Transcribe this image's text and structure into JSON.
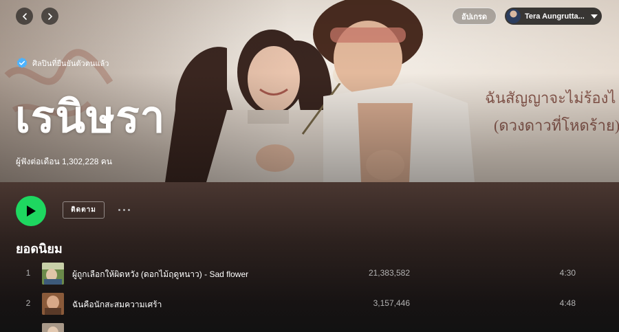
{
  "nav": {
    "back_icon": "chevron-left-icon",
    "forward_icon": "chevron-right-icon"
  },
  "header": {
    "upgrade_label": "อัปเกรด",
    "user_name": "Tera Aungrutta...",
    "caret_icon": "caret-down-icon"
  },
  "artist": {
    "verified_label": "ศิลปินที่ยืนยันตัวตนแล้ว",
    "name": "เรนิษรา",
    "monthly_listeners": "ผู้ฟังต่อเดือน 1,302,228 คน",
    "banner_text_line1": "ฉันสัญญาจะไม่ร้องไ",
    "banner_text_line2": "(ดวงดาวที่โหดร้าย)"
  },
  "actions": {
    "follow_label": "ติดตาม",
    "play_icon": "play-icon",
    "more_icon": "more-horizontal-icon"
  },
  "popular": {
    "title": "ยอดนิยม",
    "tracks": [
      {
        "num": "1",
        "title": "ผู้ถูกเลือกให้ผิดหวัง (ดอกไม้ฤดูหนาว) - Sad flower",
        "plays": "21,383,582",
        "duration": "4:30"
      },
      {
        "num": "2",
        "title": "ฉันคือนักสะสมความเศร้า",
        "plays": "3,157,446",
        "duration": "4:48"
      }
    ]
  },
  "colors": {
    "accent": "#1ed760",
    "verified": "#4cb3ff",
    "background": "#121212"
  }
}
